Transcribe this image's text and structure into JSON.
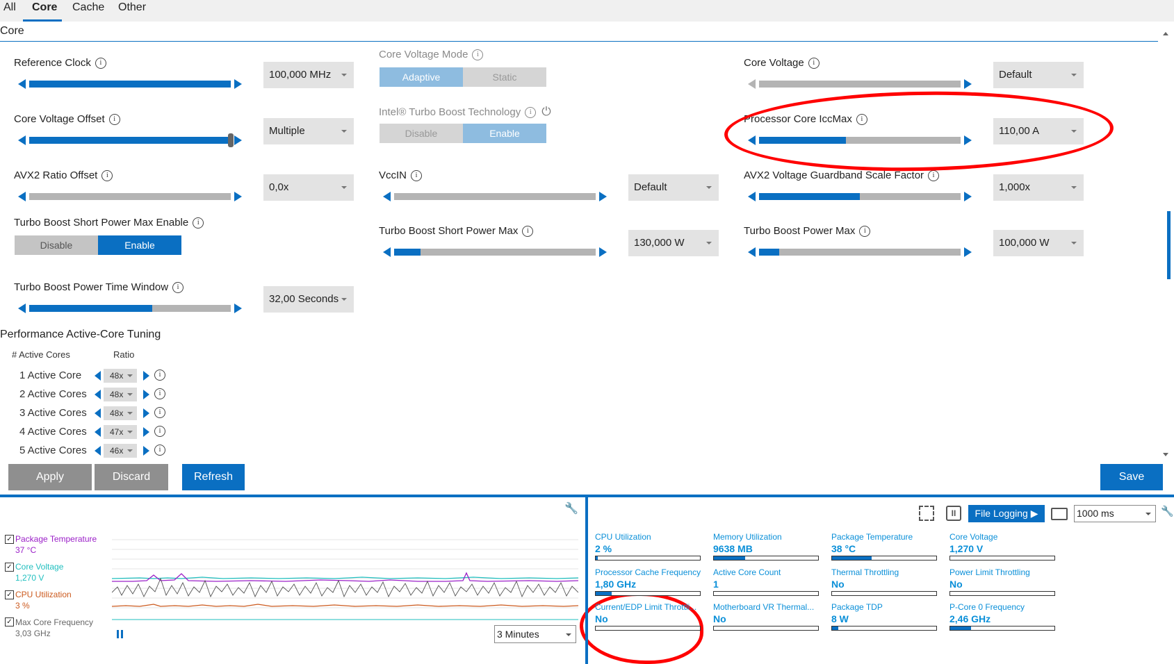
{
  "tabs": [
    {
      "label": "All",
      "active": false
    },
    {
      "label": "Core",
      "active": true
    },
    {
      "label": "Cache",
      "active": false
    },
    {
      "label": "Other",
      "active": false
    }
  ],
  "section_title": "Core",
  "controls": {
    "reference_clock": {
      "label": "Reference Clock",
      "value": "100,000 MHz",
      "level": 0.95
    },
    "core_voltage_offset": {
      "label": "Core Voltage Offset",
      "value": "Multiple",
      "level": 0.95
    },
    "avx2_ratio_offset": {
      "label": "AVX2 Ratio Offset",
      "value": "0,0x",
      "level": 0.0
    },
    "turbo_short_enable": {
      "label": "Turbo Boost Short Power Max Enable",
      "off": "Disable",
      "on": "Enable",
      "selected": "Enable"
    },
    "turbo_time_window": {
      "label": "Turbo Boost Power Time Window",
      "value": "32,00 Seconds",
      "level": 0.65
    },
    "core_voltage_mode": {
      "label": "Core Voltage Mode",
      "on": "Adaptive",
      "off": "Static",
      "selected": "Adaptive"
    },
    "intel_turbo_boost": {
      "label": "Intel® Turbo Boost Technology",
      "off": "Disable",
      "on": "Enable",
      "selected": "Enable"
    },
    "vccin": {
      "label": "VccIN",
      "value": "Default",
      "level": 0.0
    },
    "turbo_short_power_max": {
      "label": "Turbo Boost Short Power Max",
      "value": "130,000 W",
      "level": 0.13
    },
    "core_voltage": {
      "label": "Core Voltage",
      "value": "Default",
      "level": 0.0
    },
    "processor_core_iccmax": {
      "label": "Processor Core IccMax",
      "value": "110,00 A",
      "level": 0.43
    },
    "avx2_voltage_guardband": {
      "label": "AVX2 Voltage Guardband Scale Factor",
      "value": "1,000x",
      "level": 0.5
    },
    "turbo_boost_power_max": {
      "label": "Turbo Boost Power Max",
      "value": "100,000 W",
      "level": 0.1
    }
  },
  "active_core_tuning": {
    "title": "Performance Active-Core Tuning",
    "col_cores": "# Active Cores",
    "col_ratio": "Ratio",
    "rows": [
      {
        "label": "1 Active Core",
        "ratio": "48x"
      },
      {
        "label": "2 Active Cores",
        "ratio": "48x"
      },
      {
        "label": "3 Active Cores",
        "ratio": "48x"
      },
      {
        "label": "4 Active Cores",
        "ratio": "47x"
      },
      {
        "label": "5 Active Cores",
        "ratio": "46x"
      }
    ]
  },
  "buttons": {
    "apply": "Apply",
    "discard": "Discard",
    "refresh": "Refresh",
    "save": "Save"
  },
  "monitor": {
    "legend": [
      {
        "name": "Package Temperature",
        "value": "37 °C",
        "color": "#9b20c8"
      },
      {
        "name": "Core Voltage",
        "value": "1,270 V",
        "color": "#1fbfbf"
      },
      {
        "name": "CPU Utilization",
        "value": "3 %",
        "color": "#cc5a1e"
      },
      {
        "name": "Max Core Frequency",
        "value": "3,03 GHz",
        "color": "#666666"
      }
    ],
    "time_range": "3 Minutes",
    "file_logging": "File Logging ▶",
    "interval": "1000 ms",
    "metrics": [
      {
        "title": "CPU Utilization",
        "value": "2 %",
        "level": 0.02
      },
      {
        "title": "Memory Utilization",
        "value": "9638  MB",
        "level": 0.3
      },
      {
        "title": "Package Temperature",
        "value": "38 °C",
        "level": 0.38
      },
      {
        "title": "Core Voltage",
        "value": "1,270 V",
        "level": 0.0
      },
      {
        "title": "Processor Cache Frequency",
        "value": "1,80 GHz",
        "level": 0.15
      },
      {
        "title": "Active Core Count",
        "value": "1",
        "level": 0.0
      },
      {
        "title": "Thermal Throttling",
        "value": "No",
        "level": 0.0
      },
      {
        "title": "Power Limit Throttling",
        "value": "No",
        "level": 0.0
      },
      {
        "title": "Current/EDP Limit Throttli...",
        "value": "No",
        "level": 0.0
      },
      {
        "title": "Motherboard VR Thermal...",
        "value": "No",
        "level": 0.0
      },
      {
        "title": "Package TDP",
        "value": "8 W",
        "level": 0.06
      },
      {
        "title": "P-Core 0 Frequency",
        "value": "2,46 GHz",
        "level": 0.2
      }
    ]
  },
  "colors": {
    "accent": "#0a6fc2",
    "annotation": "#ff0000",
    "metric_text": "#0a8fd8"
  }
}
